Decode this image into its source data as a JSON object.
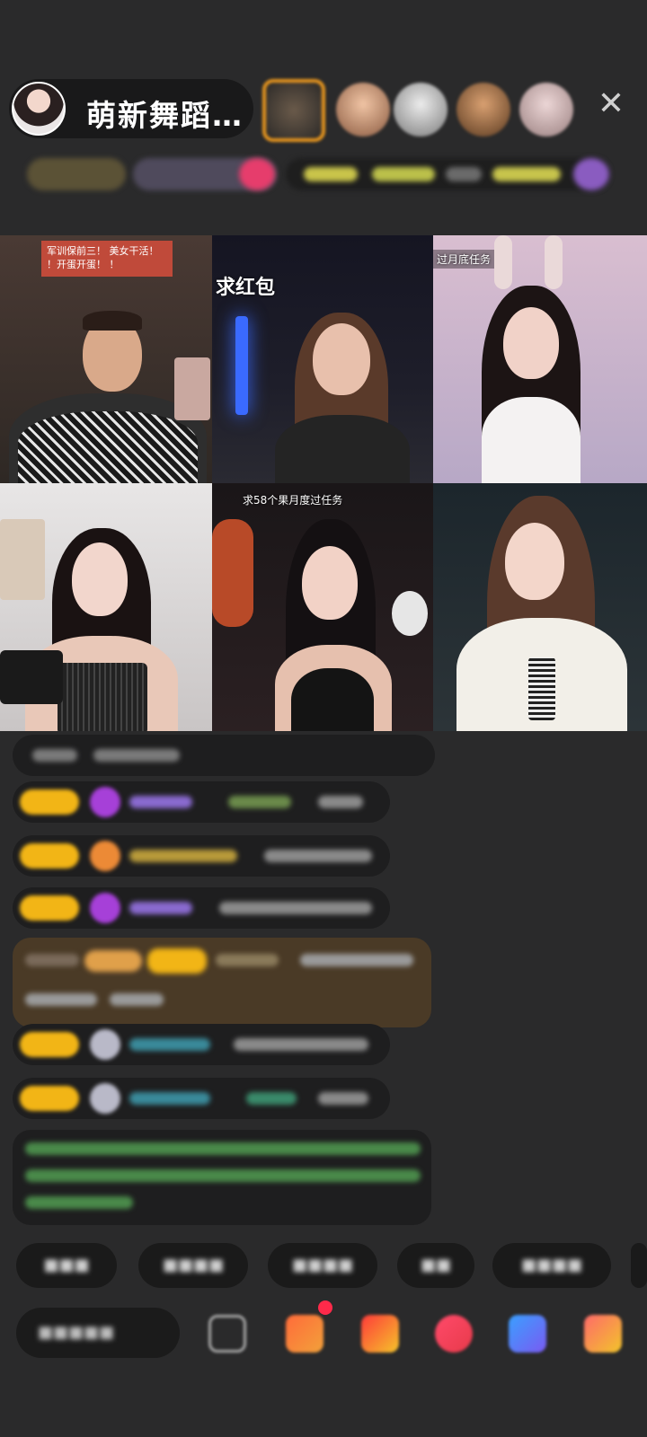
{
  "header": {
    "host_name": "萌新舞蹈…",
    "close_icon": "close-icon"
  },
  "tiles": [
    {
      "caption": "军训保前三！ 美女干活！ ！开蛋开蛋！ ！"
    },
    {
      "caption": "求红包"
    },
    {
      "caption": "过月底任务"
    },
    {
      "caption": ""
    },
    {
      "caption": "求58个果月度过任务"
    },
    {
      "caption": ""
    }
  ],
  "colors": {
    "background": "#2a2a2b",
    "badge": "#f2b516",
    "chat_bubble": "#1e1e1f",
    "gift_bubble": "#4a3a26"
  }
}
